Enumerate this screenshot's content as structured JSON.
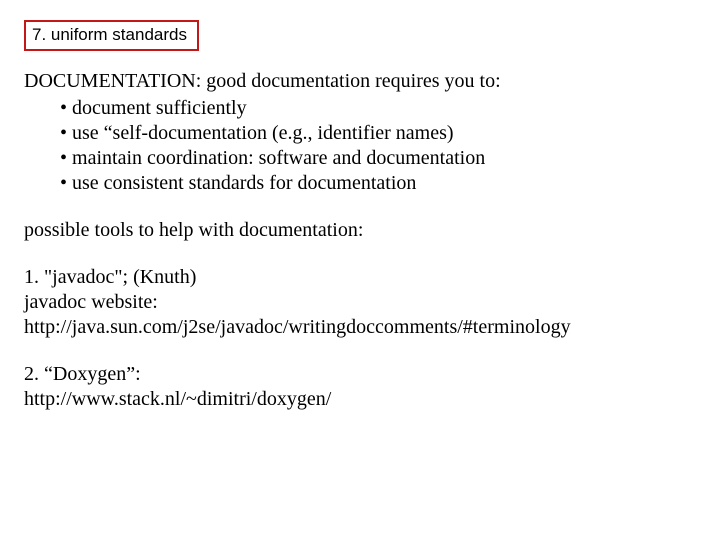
{
  "header": {
    "label": "7. uniform standards"
  },
  "doc_section": {
    "heading": "DOCUMENTATION: good documentation requires you to:",
    "bullets": [
      "document sufficiently",
      "use “self-documentation (e.g., identifier names)",
      "maintain coordination:  software and documentation",
      "use consistent standards for documentation"
    ]
  },
  "tools_intro": "possible tools to help with documentation:",
  "tool1": {
    "title": "1.  \"javadoc\"; (Knuth)",
    "label": "javadoc website:",
    "url": "http://java.sun.com/j2se/javadoc/writingdoccomments/#terminology"
  },
  "tool2": {
    "title": "2.  “Doxygen”:",
    "url": "http://www.stack.nl/~dimitri/doxygen/"
  }
}
